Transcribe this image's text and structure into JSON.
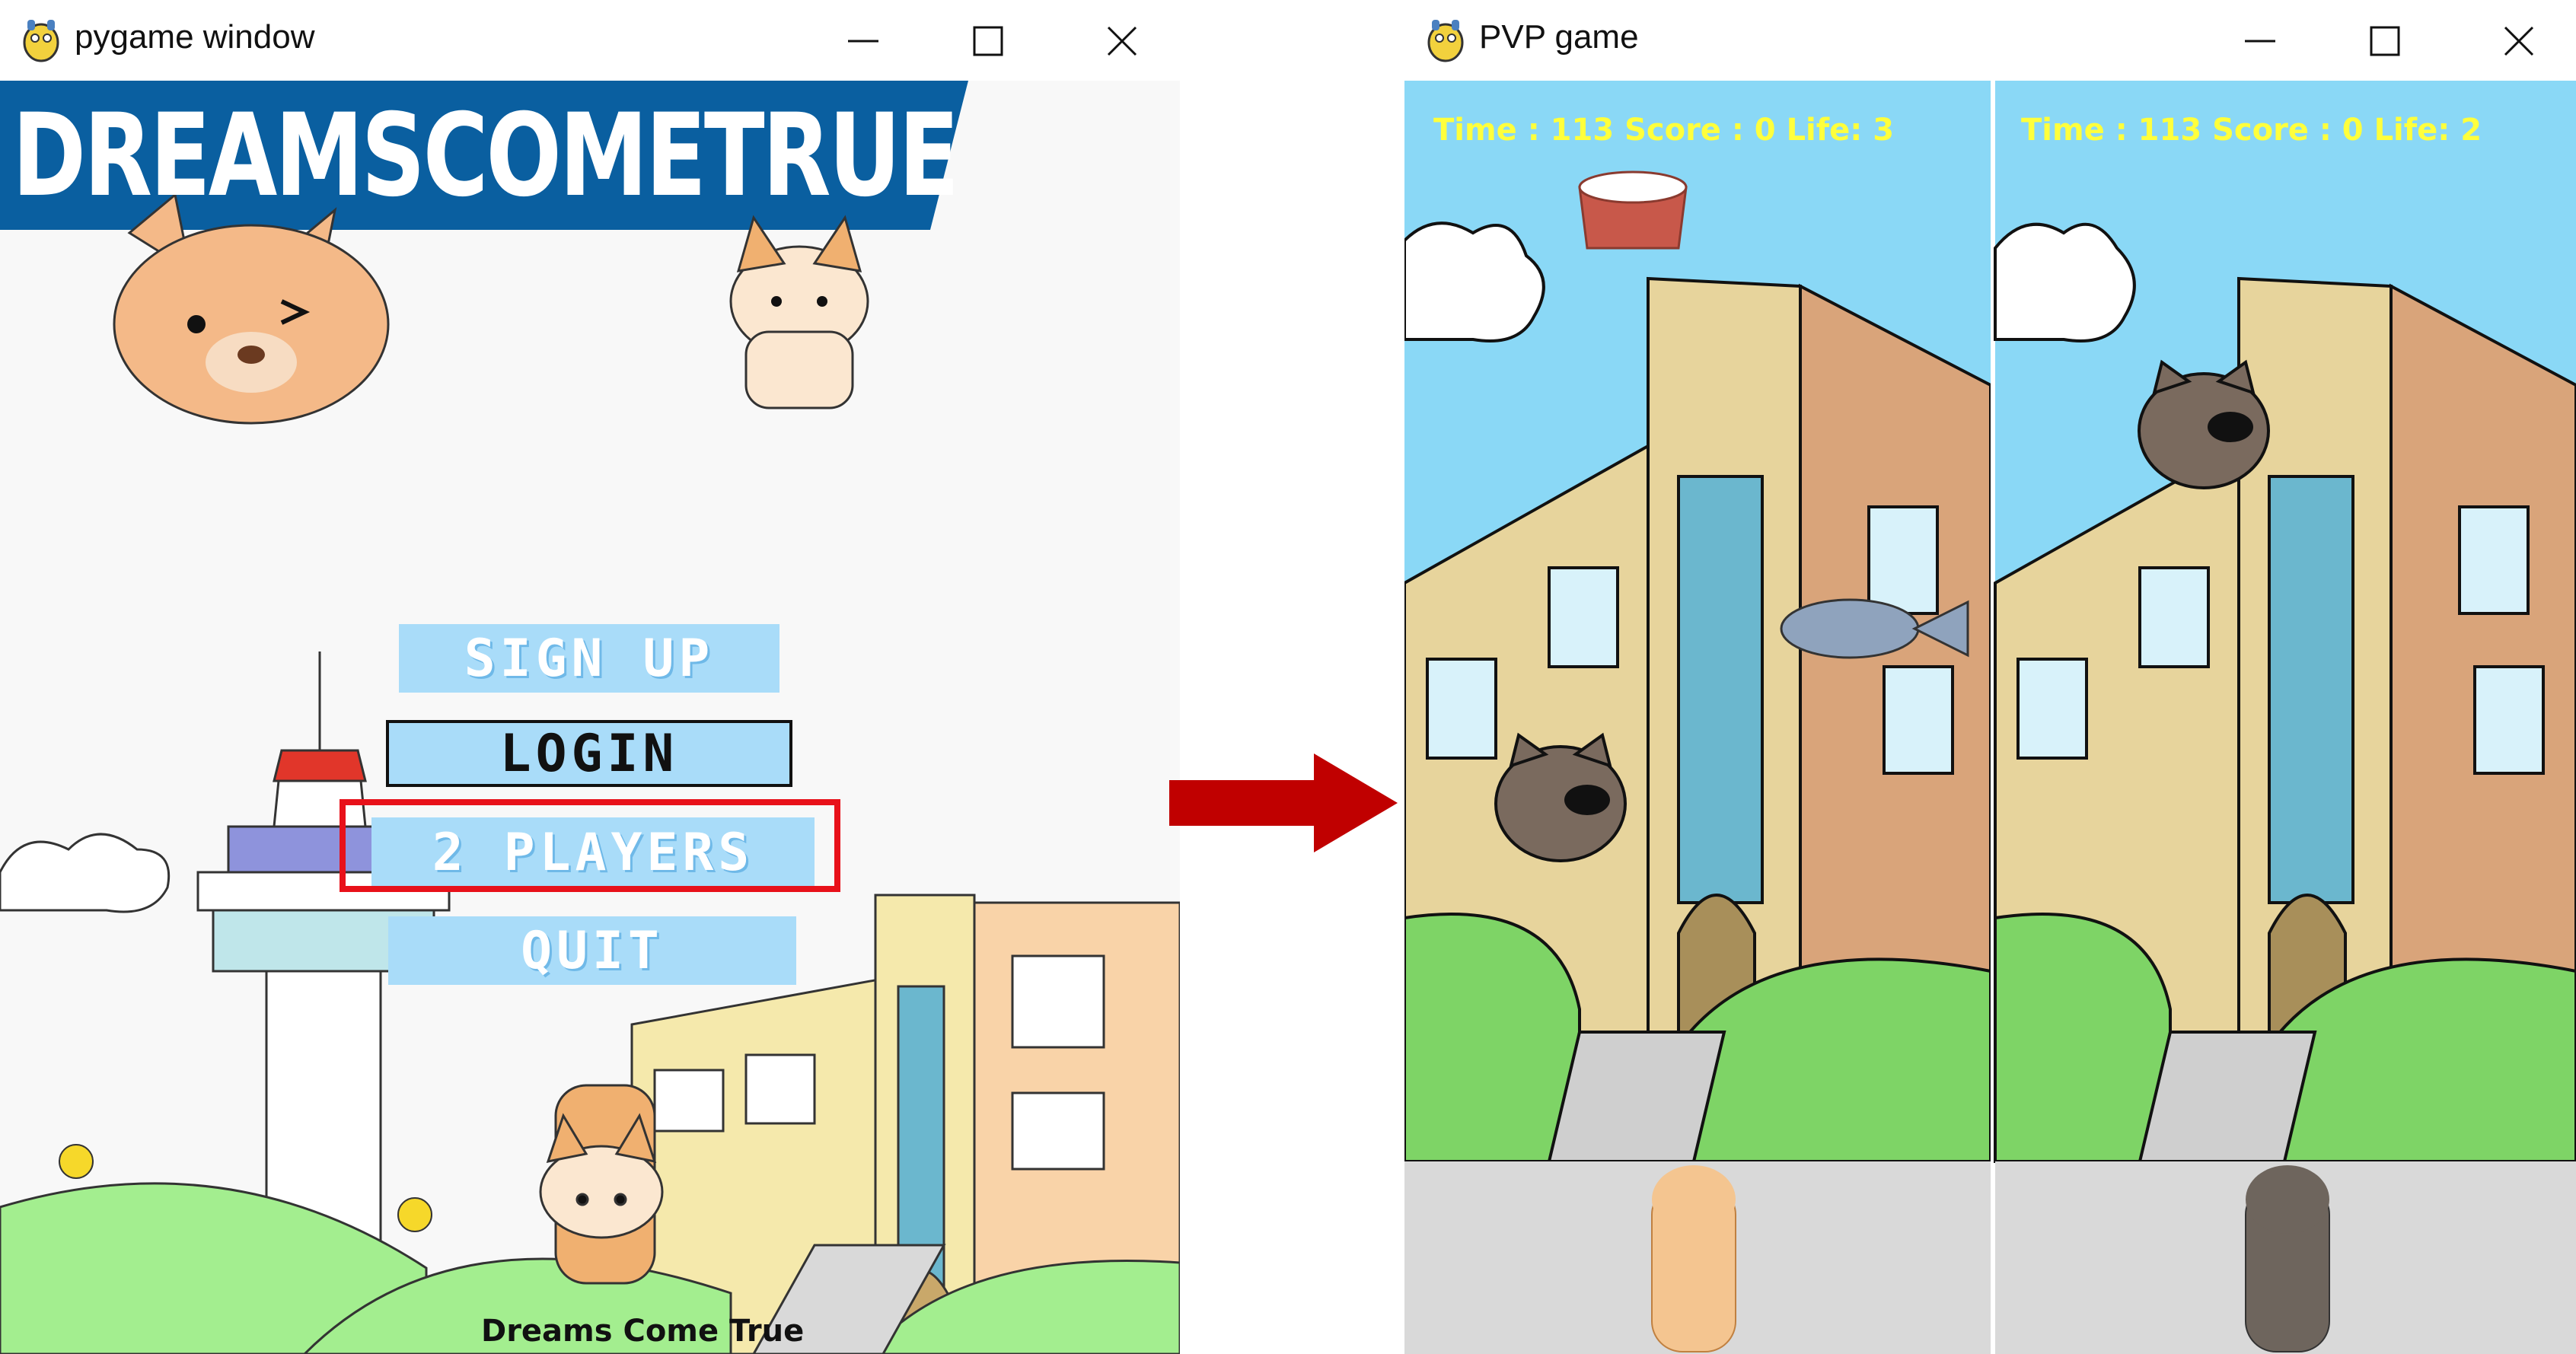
{
  "left_window": {
    "title": "pygame window",
    "banner": "DREAMSCOMETRUE",
    "menu": {
      "sign_up": "SIGN UP",
      "login": "LOGIN",
      "two_players": "2 PLAYERS",
      "quit": "QUIT"
    },
    "footer": "Dreams Come True"
  },
  "right_window": {
    "title": "PVP game",
    "player1_hud": {
      "time_label": "Time : ",
      "time": "113",
      "score_label": " Score : ",
      "score": "0",
      "life_label": " Life: ",
      "life": "3"
    },
    "player2_hud": {
      "time_label": "Time : ",
      "time": "113",
      "score_label": " Score : ",
      "score": "0",
      "life_label": " Life: ",
      "life": "2"
    }
  },
  "colors": {
    "banner_blue": "#0a5fa0",
    "button_fill": "#a9dcf9",
    "highlight_red": "#e8111a",
    "arrow_red": "#c00000",
    "hud_yellow": "#ffff3c",
    "sky": "#8ad8f6",
    "grass": "#7ed466"
  },
  "icons": [
    "pygame-logo-icon",
    "minimize-icon",
    "maximize-icon",
    "close-icon",
    "arrow-right-icon"
  ]
}
